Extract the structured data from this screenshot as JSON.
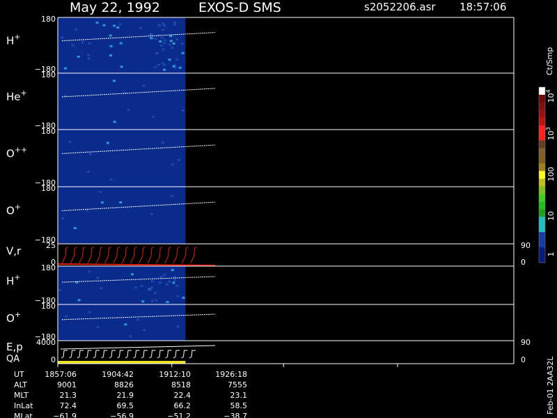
{
  "header": {
    "date": "May 22, 1992",
    "instrument": "EXOS-D SMS",
    "file": "s2052206.asr",
    "time": "18:57:06"
  },
  "colors": {
    "background": "#000000",
    "fill_blue": "#0a2a8c",
    "trace": "#ffffff",
    "velocity_trace": "#e02010",
    "quality_bar": "#e8e020"
  },
  "colorbar": {
    "label": "Ct/Smp",
    "ticks": [
      "1",
      "10",
      "100",
      "10",
      "10"
    ],
    "tick_exps": [
      "",
      "",
      "",
      "3",
      "4"
    ],
    "segments": [
      "#0a1a7a",
      "#0a1a7a",
      "#1a3aa8",
      "#1a3aa8",
      "#20c0c0",
      "#20c0c0",
      "#20a020",
      "#20c020",
      "#40d020",
      "#80c020",
      "#c0c020",
      "#ffff20",
      "#a08020",
      "#806020",
      "#806030",
      "#604020",
      "#ff2020",
      "#ff2020",
      "#c01010",
      "#a01010",
      "#801010",
      "#700808",
      "#ffffff"
    ]
  },
  "chart_data": {
    "type": "heatmap",
    "panels": [
      {
        "name": "H",
        "sup": "+",
        "ylim": [
          -180,
          180
        ],
        "ticks": [
          "180",
          "−180"
        ],
        "intensity": "high"
      },
      {
        "name": "He",
        "sup": "+",
        "ylim": [
          -180,
          180
        ],
        "ticks": [
          "180",
          "−180"
        ],
        "intensity": "low"
      },
      {
        "name": "O",
        "sup": "++",
        "ylim": [
          -180,
          180
        ],
        "ticks": [
          "180",
          "−180"
        ],
        "intensity": "low"
      },
      {
        "name": "O",
        "sup": "+",
        "ylim": [
          -180,
          180
        ],
        "ticks": [
          "180",
          "−180"
        ],
        "intensity": "low"
      },
      {
        "name": "V,r",
        "sup": "",
        "ylim": [
          0,
          25
        ],
        "ticks": [
          "25",
          "0"
        ],
        "right_ticks": [
          "90",
          "0"
        ],
        "type": "line"
      },
      {
        "name": "H",
        "sup": "+",
        "ylim": [
          -180,
          180
        ],
        "ticks": [
          "180",
          "−180"
        ],
        "intensity": "medium"
      },
      {
        "name": "O",
        "sup": "+",
        "ylim": [
          -180,
          180
        ],
        "ticks": [
          "180",
          "−180"
        ],
        "intensity": "low"
      },
      {
        "name": "E,p",
        "sup": "",
        "name2": "QA",
        "ylim": [
          0,
          4000
        ],
        "ticks": [
          "4000",
          "0"
        ],
        "right_ticks": [
          "90",
          "0"
        ],
        "type": "line"
      }
    ],
    "time_ticks": [
      "1857:06",
      "1904:42",
      "1912:10",
      "1926:18"
    ],
    "data_coverage": [
      0,
      0.28
    ],
    "ephemeris": [
      {
        "label": "UT",
        "values": [
          "1857:06",
          "1904:42",
          "1912:10",
          "1926:18"
        ]
      },
      {
        "label": "ALT",
        "values": [
          "9001",
          "8826",
          "8518",
          "7555"
        ]
      },
      {
        "label": "MLT",
        "values": [
          "21.3",
          "21.9",
          "22.4",
          "23.1"
        ]
      },
      {
        "label": "InLat",
        "values": [
          "72.4",
          "69.5",
          "66.2",
          "58.5"
        ]
      },
      {
        "label": "MLat",
        "values": [
          "−61.9",
          "−56.9",
          "−51.2",
          "−38.7"
        ]
      }
    ]
  },
  "footer": {
    "side_label": "Feb-01 2AA32L"
  }
}
